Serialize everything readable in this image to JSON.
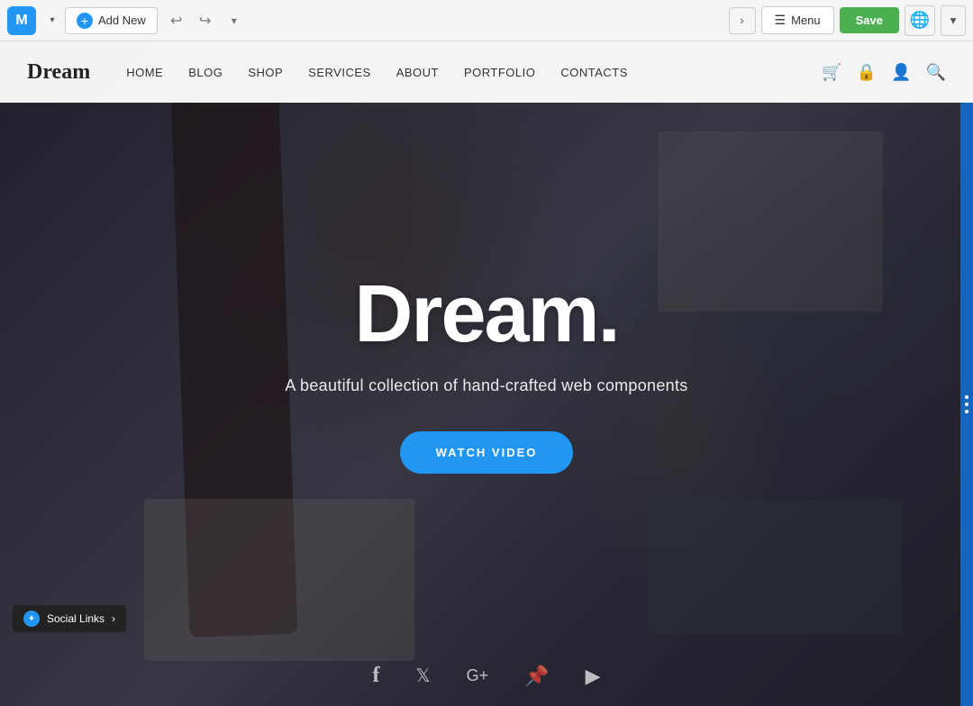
{
  "toolbar": {
    "logo_letter": "M",
    "add_new_label": "Add New",
    "undo_icon": "↩",
    "redo_icon": "↪",
    "menu_label": "Menu",
    "save_label": "Save",
    "globe_icon": "🌐",
    "arrow_right_icon": "›",
    "more_icon": "▾"
  },
  "site": {
    "logo": "Dream",
    "nav_items": [
      {
        "label": "HOME"
      },
      {
        "label": "BLOG"
      },
      {
        "label": "SHOP"
      },
      {
        "label": "SERVICES"
      },
      {
        "label": "ABOUT"
      },
      {
        "label": "PORTFOLIO"
      },
      {
        "label": "CONTACTS"
      }
    ],
    "hero": {
      "title": "Dream.",
      "subtitle": "A beautiful collection of hand-crafted web components",
      "cta_label": "WATCH VIDEO"
    },
    "social": {
      "tag_label": "Social Links",
      "tag_arrow": "›",
      "icons": [
        "f",
        "t",
        "G+",
        "♟",
        "▶"
      ]
    }
  }
}
